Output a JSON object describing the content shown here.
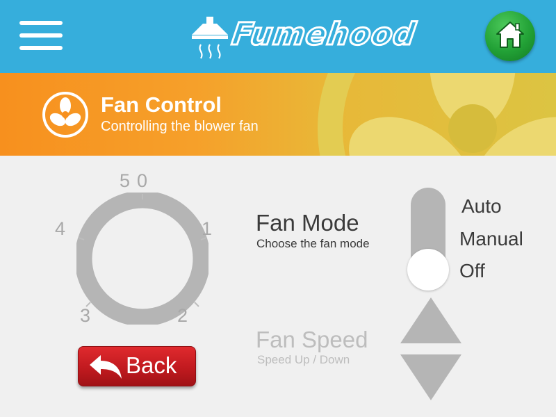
{
  "app": {
    "brand": "Fumehood",
    "icons": {
      "menu": "hamburger-menu-icon",
      "home": "home-icon",
      "logo": "range-hood-icon"
    }
  },
  "header": {
    "title": "Fan Control",
    "subtitle": "Controlling the blower fan",
    "icon": "fan-icon"
  },
  "dial": {
    "labels": [
      "0",
      "1",
      "2",
      "3",
      "4",
      "5"
    ]
  },
  "back_button": {
    "label": "Back",
    "icon": "back-arrow-icon"
  },
  "fan_mode": {
    "title": "Fan Mode",
    "subtitle": "Choose the fan mode",
    "options": [
      "Auto",
      "Manual",
      "Off"
    ],
    "selected": "Off"
  },
  "fan_speed": {
    "title": "Fan Speed",
    "subtitle": "Speed Up / Down",
    "enabled": false
  },
  "colors": {
    "topbar": "#36aedc",
    "header_start": "#f7901e",
    "header_end": "#dcc442",
    "home_button": "#22a136",
    "back_button": "#c11a1f",
    "muted": "#b5b5b5"
  }
}
